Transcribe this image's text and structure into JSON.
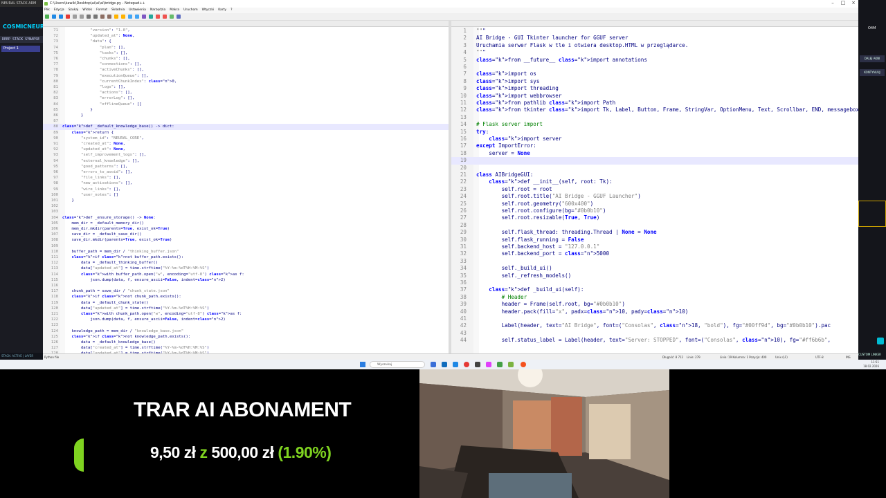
{
  "window": {
    "title": "C:\\Users\\kawik\\Desktop\\ai\\ai\\ai\\bridge.py - Notepad++",
    "menu": [
      "Plik",
      "Edycja",
      "Szukaj",
      "Widok",
      "Format",
      "Składnia",
      "Ustawienia",
      "Narzędzia",
      "Makra",
      "Uruchom",
      "Wtyczki",
      "Karty",
      "?"
    ]
  },
  "left_app": {
    "tab": "NEURAL STACK ARM",
    "logo": "COSMICNEUR",
    "stack_line": "DEEP STACK SYNAPSE",
    "project": "Project 1",
    "footer": "STACK: ACTIVE | LAYER"
  },
  "left_pane": {
    "first_line": 71,
    "lines": [
      "            \"version\": \"1.0\",",
      "            \"updated_at\": None,",
      "            \"data\": {",
      "                \"plan\": [],",
      "                \"tasks\": [],",
      "                \"chunks\": [],",
      "                \"connections\": [],",
      "                \"activeChunks\": [],",
      "                \"executionQueue\": [],",
      "                \"currentChunkIndex\": 0,",
      "                \"logs\": [],",
      "                \"actions\": [],",
      "                \"errorLog\": [],",
      "                \"offlineQueue\": []",
      "            }",
      "        }",
      "",
      "def _default_knowledge_base() -> dict:",
      "    return {",
      "        \"system_id\": \"NEURAL_CORE\",",
      "        \"created_at\": None,",
      "        \"updated_at\": None,",
      "        \"self_improvement_logs\": [],",
      "        \"external_knowledge\": [],",
      "        \"good_patterns\": [],",
      "        \"errors_to_avoid\": [],",
      "        \"file_links\": [],",
      "        \"new_activations\": [],",
      "        \"wire_links\": [],",
      "        \"user_notes\": []",
      "    }",
      "",
      "",
      "def _ensure_storage() -> None:",
      "    mem_dir = _default_memory_dir()",
      "    mem_dir.mkdir(parents=True, exist_ok=True)",
      "    save_dir = _default_save_dir()",
      "    save_dir.mkdir(parents=True, exist_ok=True)",
      "",
      "    buffer_path = mem_dir / \"thinking_buffer.json\"",
      "    if not buffer_path.exists():",
      "        data = _default_thinking_buffer()",
      "        data[\"updated_at\"] = time.strftime(\"%Y-%m-%dT%H:%M:%S\")",
      "        with buffer_path.open(\"w\", encoding=\"utf-8\") as f:",
      "            json.dump(data, f, ensure_ascii=False, indent=2)",
      "",
      "    chunk_path = save_dir / \"chunk_state.json\"",
      "    if not chunk_path.exists():",
      "        data = _default_chunk_state()",
      "        data[\"updated_at\"] = time.strftime(\"%Y-%m-%dT%H:%M:%S\")",
      "        with chunk_path.open(\"w\", encoding=\"utf-8\") as f:",
      "            json.dump(data, f, ensure_ascii=False, indent=2)",
      "",
      "    knowledge_path = mem_dir / \"knowledge_base.json\"",
      "    if not knowledge_path.exists():",
      "        data = _default_knowledge_base()",
      "        data[\"created_at\"] = time.strftime(\"%Y-%m-%dT%H:%M:%S\")",
      "        data[\"updated_at\"] = time.strftime(\"%Y-%m-%dT%H:%M:%S\")"
    ]
  },
  "right_pane": {
    "first_line": 1,
    "lines": [
      "\"\"\"",
      "AI Bridge - GUI Tkinter launcher for GGUF server",
      "Uruchamia serwer Flask w tle i otwiera desktop.HTML w przeglądarce.",
      "\"\"\"",
      "from __future__ import annotations",
      "",
      "import os",
      "import sys",
      "import threading",
      "import webbrowser",
      "from pathlib import Path",
      "from tkinter import Tk, Label, Button, Frame, StringVar, OptionMenu, Text, Scrollbar, END, messagebox",
      "",
      "# Flask server import",
      "try:",
      "    import server",
      "except ImportError:",
      "    server = None",
      "",
      "",
      "class AIBridgeGUI:",
      "    def __init__(self, root: Tk):",
      "        self.root = root",
      "        self.root.title(\"AI Bridge - GGUF Launcher\")",
      "        self.root.geometry(\"600x400\")",
      "        self.root.configure(bg=\"#0b0b10\")",
      "        self.root.resizable(True, True)",
      "",
      "        self.flask_thread: threading.Thread | None = None",
      "        self.flask_running = False",
      "        self.backend_host = \"127.0.0.1\"",
      "        self.backend_port = 5000",
      "",
      "        self._build_ui()",
      "        self._refresh_models()",
      "",
      "    def _build_ui(self):",
      "        # Header",
      "        header = Frame(self.root, bg=\"#0b0b10\")",
      "        header.pack(fill=\"x\", padx=10, pady=10)",
      "",
      "        Label(header, text=\"AI Bridge\", font=(\"Consolas\", 18, \"bold\"), fg=\"#00ff9d\", bg=\"#0b0b10\").pac",
      "",
      "        self.status_label = Label(header, text=\"Server: STOPPED\", font=(\"Consolas\", 10), fg=\"#ff6b6b\","
    ]
  },
  "status": {
    "left": "Python file",
    "length": "Długość: 8 712",
    "lines": "Linie: 279",
    "pos": "Linia: 19   Kolumna: 1   Pozycja: 400",
    "eol": "Unix (LF)",
    "enc": "UTF-8",
    "ins": "INS"
  },
  "right_app": {
    "top": "O4M",
    "btn1": "DALEJ AKNI",
    "btn2": "KONTYNUUJ",
    "bottom": "CUSTOM LINKER"
  },
  "taskbar": {
    "search": "Wyszukaj",
    "time": "11:51",
    "date": "18.02.2026"
  },
  "overlay": {
    "title": "TRAR AI ABONAMENT",
    "current": "9,50 zł",
    "sep": "z",
    "goal": "500,00 zł",
    "percent": "(1.90%)",
    "progress": 0.019,
    "colors": {
      "accent": "#7fd320",
      "text": "#ffffff"
    }
  }
}
